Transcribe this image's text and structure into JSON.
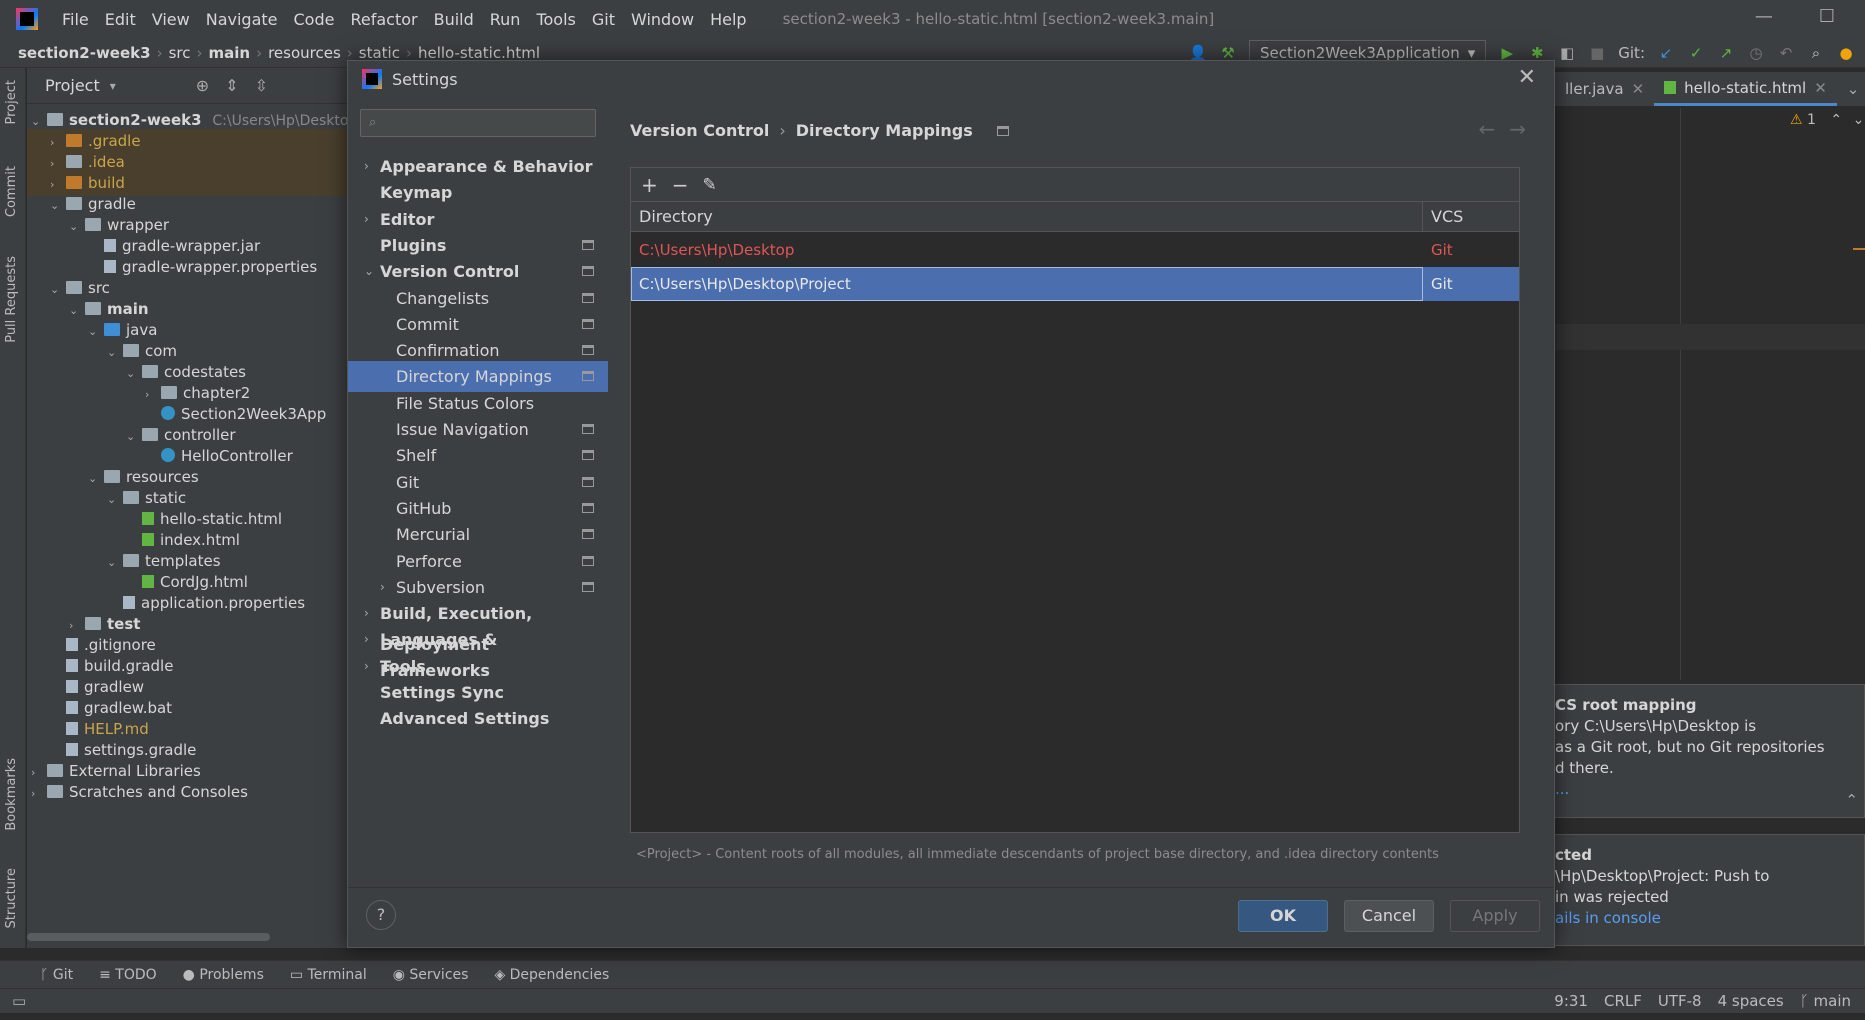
{
  "menubar": {
    "items": [
      "File",
      "Edit",
      "View",
      "Navigate",
      "Code",
      "Refactor",
      "Build",
      "Run",
      "Tools",
      "Git",
      "Window",
      "Help"
    ],
    "window_title": "section2-week3 - hello-static.html [section2-week3.main]"
  },
  "navbar": {
    "crumbs": [
      "section2-week3",
      "src",
      "main",
      "resources",
      "static",
      "hello-static.html"
    ],
    "run_config": "Section2Week3Application",
    "git_label": "Git:"
  },
  "toolstrip": {
    "project": "Project",
    "commit": "Commit",
    "pull_requests": "Pull Requests",
    "bookmarks": "Bookmarks",
    "structure": "Structure"
  },
  "project": {
    "title": "Project",
    "root": "section2-week3",
    "root_path": "C:\\Users\\Hp\\Deskto",
    "tree": [
      {
        "label": ".gradle",
        "depth": 1,
        "arrow": "›",
        "icon": "folder orange",
        "color": "#c9a64a",
        "hl": true
      },
      {
        "label": ".idea",
        "depth": 1,
        "arrow": "›",
        "icon": "folder",
        "color": "#c9a64a",
        "hl": true
      },
      {
        "label": "build",
        "depth": 1,
        "arrow": "›",
        "icon": "folder orange",
        "color": "#c9a64a",
        "hl": true
      },
      {
        "label": "gradle",
        "depth": 1,
        "arrow": "⌄",
        "icon": "folder",
        "color": "#d6d6d6"
      },
      {
        "label": "wrapper",
        "depth": 2,
        "arrow": "⌄",
        "icon": "folder",
        "color": "#d6d6d6"
      },
      {
        "label": "gradle-wrapper.jar",
        "depth": 3,
        "arrow": "",
        "icon": "file",
        "color": "#d6d6d6"
      },
      {
        "label": "gradle-wrapper.properties",
        "depth": 3,
        "arrow": "",
        "icon": "file",
        "color": "#d6d6d6"
      },
      {
        "label": "src",
        "depth": 1,
        "arrow": "⌄",
        "icon": "folder",
        "color": "#d6d6d6"
      },
      {
        "label": "main",
        "depth": 2,
        "arrow": "⌄",
        "icon": "folder",
        "color": "#d6d6d6",
        "bold": true
      },
      {
        "label": "java",
        "depth": 3,
        "arrow": "⌄",
        "icon": "folder blue",
        "color": "#d6d6d6"
      },
      {
        "label": "com",
        "depth": 4,
        "arrow": "⌄",
        "icon": "folder",
        "color": "#d6d6d6"
      },
      {
        "label": "codestates",
        "depth": 5,
        "arrow": "⌄",
        "icon": "folder",
        "color": "#d6d6d6"
      },
      {
        "label": "chapter2",
        "depth": 6,
        "arrow": "›",
        "icon": "folder",
        "color": "#d6d6d6"
      },
      {
        "label": "Section2Week3App",
        "depth": 6,
        "arrow": "",
        "icon": "jclass",
        "color": "#d6d6d6"
      },
      {
        "label": "controller",
        "depth": 5,
        "arrow": "⌄",
        "icon": "folder",
        "color": "#d6d6d6"
      },
      {
        "label": "HelloController",
        "depth": 6,
        "arrow": "",
        "icon": "jclass",
        "color": "#d6d6d6"
      },
      {
        "label": "resources",
        "depth": 3,
        "arrow": "⌄",
        "icon": "folder",
        "color": "#d6d6d6"
      },
      {
        "label": "static",
        "depth": 4,
        "arrow": "⌄",
        "icon": "folder",
        "color": "#d6d6d6"
      },
      {
        "label": "hello-static.html",
        "depth": 5,
        "arrow": "",
        "icon": "file green",
        "color": "#d6d6d6"
      },
      {
        "label": "index.html",
        "depth": 5,
        "arrow": "",
        "icon": "file green",
        "color": "#d6d6d6"
      },
      {
        "label": "templates",
        "depth": 4,
        "arrow": "⌄",
        "icon": "folder",
        "color": "#d6d6d6"
      },
      {
        "label": "CordJg.html",
        "depth": 5,
        "arrow": "",
        "icon": "file green",
        "color": "#d6d6d6"
      },
      {
        "label": "application.properties",
        "depth": 4,
        "arrow": "",
        "icon": "file",
        "color": "#d6d6d6"
      },
      {
        "label": "test",
        "depth": 2,
        "arrow": "›",
        "icon": "folder",
        "color": "#d6d6d6",
        "bold": true
      },
      {
        "label": ".gitignore",
        "depth": 1,
        "arrow": "",
        "icon": "file",
        "color": "#d6d6d6"
      },
      {
        "label": "build.gradle",
        "depth": 1,
        "arrow": "",
        "icon": "file",
        "color": "#d6d6d6"
      },
      {
        "label": "gradlew",
        "depth": 1,
        "arrow": "",
        "icon": "file",
        "color": "#d6d6d6"
      },
      {
        "label": "gradlew.bat",
        "depth": 1,
        "arrow": "",
        "icon": "file",
        "color": "#d6d6d6"
      },
      {
        "label": "HELP.md",
        "depth": 1,
        "arrow": "",
        "icon": "file",
        "color": "#c9a64a"
      },
      {
        "label": "settings.gradle",
        "depth": 1,
        "arrow": "",
        "icon": "file",
        "color": "#d6d6d6"
      },
      {
        "label": "External Libraries",
        "depth": 0,
        "arrow": "›",
        "icon": "folder",
        "color": "#d6d6d6"
      },
      {
        "label": "Scratches and Consoles",
        "depth": 0,
        "arrow": "›",
        "icon": "folder",
        "color": "#d6d6d6"
      }
    ]
  },
  "editor": {
    "tabs": [
      "ller.java",
      "hello-static.html"
    ],
    "warning_count": "1"
  },
  "notifications": {
    "n1_title": "CS root mapping",
    "n1_line1": "ory C:\\Users\\Hp\\Desktop is",
    "n1_line2": " as a Git root, but no Git repositories",
    "n1_line3": "d there.",
    "n1_link": "...",
    "n2_title": "cted",
    "n2_line1": "\\Hp\\Desktop\\Project: Push to",
    "n2_line2": "in was rejected",
    "n2_link": "ails in console"
  },
  "bottombar": {
    "items": [
      "Git",
      "TODO",
      "Problems",
      "Terminal",
      "Services",
      "Dependencies"
    ]
  },
  "statusbar": {
    "position": "9:31",
    "line_sep": "CRLF",
    "encoding": "UTF-8",
    "indent": "4 spaces",
    "branch": "main"
  },
  "dialog": {
    "title": "Settings",
    "search_placeholder": "",
    "nav": [
      {
        "label": "Appearance & Behavior",
        "chev": "›",
        "bold": true,
        "indent": 0,
        "proj": false
      },
      {
        "label": "Keymap",
        "chev": "",
        "bold": true,
        "indent": 0,
        "proj": false
      },
      {
        "label": "Editor",
        "chev": "›",
        "bold": true,
        "indent": 0,
        "proj": false
      },
      {
        "label": "Plugins",
        "chev": "",
        "bold": true,
        "indent": 0,
        "proj": true
      },
      {
        "label": "Version Control",
        "chev": "⌄",
        "bold": true,
        "indent": 0,
        "proj": true
      },
      {
        "label": "Changelists",
        "chev": "",
        "bold": false,
        "indent": 1,
        "proj": true
      },
      {
        "label": "Commit",
        "chev": "",
        "bold": false,
        "indent": 1,
        "proj": true
      },
      {
        "label": "Confirmation",
        "chev": "",
        "bold": false,
        "indent": 1,
        "proj": true
      },
      {
        "label": "Directory Mappings",
        "chev": "",
        "bold": false,
        "indent": 1,
        "proj": true,
        "sel": true
      },
      {
        "label": "File Status Colors",
        "chev": "",
        "bold": false,
        "indent": 1,
        "proj": false
      },
      {
        "label": "Issue Navigation",
        "chev": "",
        "bold": false,
        "indent": 1,
        "proj": true
      },
      {
        "label": "Shelf",
        "chev": "",
        "bold": false,
        "indent": 1,
        "proj": true
      },
      {
        "label": "Git",
        "chev": "",
        "bold": false,
        "indent": 1,
        "proj": true
      },
      {
        "label": "GitHub",
        "chev": "",
        "bold": false,
        "indent": 1,
        "proj": true
      },
      {
        "label": "Mercurial",
        "chev": "",
        "bold": false,
        "indent": 1,
        "proj": true
      },
      {
        "label": "Perforce",
        "chev": "",
        "bold": false,
        "indent": 1,
        "proj": true
      },
      {
        "label": "Subversion",
        "chev": "›",
        "bold": false,
        "indent": 1,
        "proj": true
      },
      {
        "label": "Build, Execution, Deployment",
        "chev": "›",
        "bold": true,
        "indent": 0,
        "proj": false
      },
      {
        "label": "Languages & Frameworks",
        "chev": "›",
        "bold": true,
        "indent": 0,
        "proj": false
      },
      {
        "label": "Tools",
        "chev": "›",
        "bold": true,
        "indent": 0,
        "proj": false
      },
      {
        "label": "Settings Sync",
        "chev": "",
        "bold": true,
        "indent": 0,
        "proj": false
      },
      {
        "label": "Advanced Settings",
        "chev": "",
        "bold": true,
        "indent": 0,
        "proj": false
      }
    ],
    "breadcrumb": {
      "parent": "Version Control",
      "current": "Directory Mappings"
    },
    "table": {
      "headers": {
        "directory": "Directory",
        "vcs": "VCS"
      },
      "rows": [
        {
          "directory": "C:\\Users\\Hp\\Desktop",
          "vcs": "Git",
          "state": "err"
        },
        {
          "directory": "C:\\Users\\Hp\\Desktop\\Project",
          "vcs": "Git",
          "state": "sel"
        }
      ]
    },
    "hint": "<Project> - Content roots of all modules, all immediate descendants of project base directory, and .idea directory contents",
    "buttons": {
      "ok": "OK",
      "cancel": "Cancel",
      "apply": "Apply",
      "help": "?"
    },
    "colors": {
      "selection": "#4b6eaf",
      "error": "#e05555",
      "primary": "#365880"
    }
  }
}
